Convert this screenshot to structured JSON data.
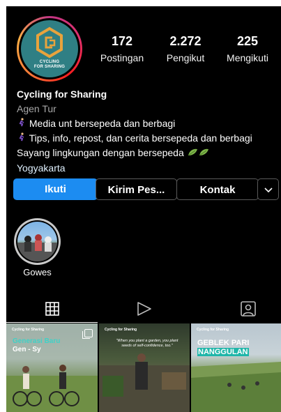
{
  "profile": {
    "name": "Cycling for Sharing",
    "category": "Agen Tur",
    "bio_lines": [
      "Media unt bersepeda dan berbagi",
      "Tips, info, repost, dan cerita bersepeda dan berbagi",
      "Sayang lingkungan dengan bersepeda"
    ],
    "location": "Yogyakarta",
    "logo_text_1": "CYCLING",
    "logo_text_2": "FOR SHARING"
  },
  "stats": [
    {
      "value": "172",
      "label": "Postingan"
    },
    {
      "value": "2.272",
      "label": "Pengikut"
    },
    {
      "value": "225",
      "label": "Mengikuti"
    }
  ],
  "buttons": {
    "follow": "Ikuti",
    "message": "Kirim Pes...",
    "contact": "Kontak"
  },
  "highlights": [
    {
      "label": "Gowes"
    }
  ],
  "tabs": [
    {
      "icon": "grid-icon",
      "active": true
    },
    {
      "icon": "reels-icon",
      "active": false
    },
    {
      "icon": "tagged-icon",
      "active": false
    }
  ],
  "posts": [
    {
      "brand": "Cycling for Sharing",
      "title_a": "Generasi Baru",
      "title_b": "Gen - Sy"
    },
    {
      "brand": "Cycling for Sharing",
      "quote": "\"When you plant a garden, you plant seeds of self-confidence, too.\""
    },
    {
      "brand": "Cycling for Sharing",
      "title_a": "GEBLEK PARI",
      "title_b": "NANGGULAN"
    }
  ],
  "colors": {
    "accent": "#1c8cf1",
    "background": "#000000",
    "teal": "#2f7f84"
  }
}
